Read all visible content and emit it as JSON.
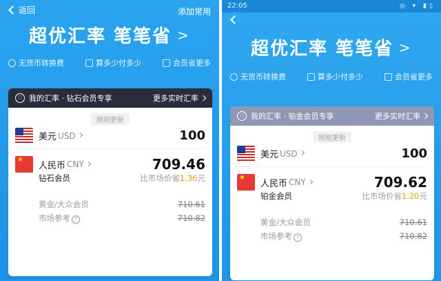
{
  "left": {
    "topbar": {
      "back_label": "返回",
      "right_label": "添加常用"
    },
    "headline": "超优汇率 笔笔省",
    "headline_arrow": ">",
    "features": [
      "无货币转换费",
      "算多少付多少",
      "会员省更多"
    ],
    "card": {
      "header_title": "我的汇率 · 钻石会员专享",
      "header_link": "更多实时汇率",
      "header_color": "#2a2c3a",
      "refresh_label": "刚刚更新",
      "from": {
        "name": "美元",
        "code": "USD",
        "amount": "100"
      },
      "to": {
        "name": "人民币",
        "code": "CNY",
        "amount": "709.46"
      },
      "member_label": "钻石会员",
      "save_prefix": "比市场价省",
      "save_value": "1.36",
      "save_unit": "元",
      "others": [
        {
          "label": "黄金/大众会员",
          "value": "710.61"
        },
        {
          "label": "市场参考",
          "value": "710.82"
        }
      ]
    }
  },
  "right": {
    "status": {
      "time": "22:05",
      "icons": "◎ ▾ ▮▯"
    },
    "headline": "超优汇率 笔笔省",
    "headline_arrow": ">",
    "features": [
      "无货币转换费",
      "算多少付多少",
      "会员省更多"
    ],
    "card": {
      "header_title": "我的汇率 · 铂金会员专享",
      "header_link": "更多实时汇率",
      "header_color": "#8e97b4",
      "refresh_label": "刚刚更新",
      "from": {
        "name": "美元",
        "code": "USD",
        "amount": "100"
      },
      "to": {
        "name": "人民币",
        "code": "CNY",
        "amount": "709.62"
      },
      "member_label": "铂金会员",
      "save_prefix": "比市场价省",
      "save_value": "1.20",
      "save_unit": "元",
      "others": [
        {
          "label": "黄金/大众会员",
          "value": "710.61"
        },
        {
          "label": "市场参考",
          "value": "710.82"
        }
      ]
    }
  },
  "colors": {
    "brand_blue": "#1d93e6",
    "save_highlight": "#e6a00c"
  }
}
